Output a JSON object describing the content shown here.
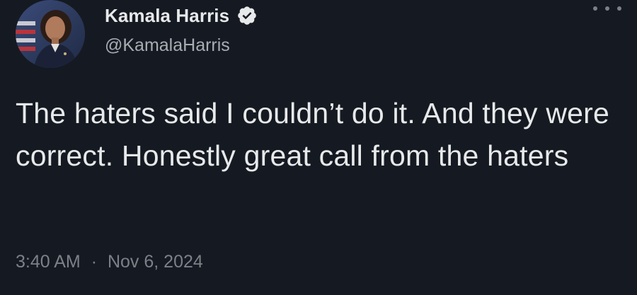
{
  "theme": {
    "background": "#151a22",
    "text_primary": "#e7e9ea",
    "text_secondary": "#a7adb3",
    "text_muted": "#7b8187",
    "verified_badge": "#e7e9ea",
    "menu_dots": "#7b8187"
  },
  "author": {
    "display_name": "Kamala Harris",
    "handle": "@KamalaHarris",
    "verified": true,
    "avatar_icon": "profile-photo",
    "verified_icon": "verified-badge-icon"
  },
  "tweet": {
    "text": "The haters said I couldn’t do it. And they were correct. Honestly great call from the haters",
    "time": "3:40 AM",
    "separator": "·",
    "date": "Nov 6, 2024"
  },
  "menu": {
    "icon": "more-options-icon"
  }
}
